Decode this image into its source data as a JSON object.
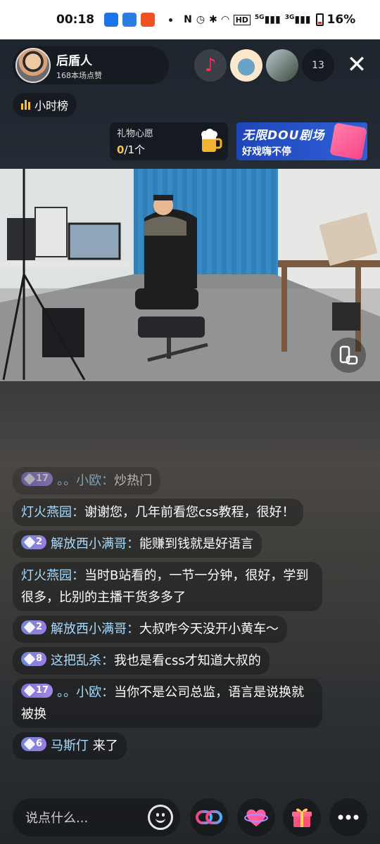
{
  "status_bar": {
    "time": "00:18",
    "network": "5G",
    "network2": "3G",
    "battery": "16%",
    "hd": "HD"
  },
  "host": {
    "name": "后盾人",
    "likes": "168本场点赞"
  },
  "viewers": {
    "count": "13"
  },
  "rank_chip": {
    "label": "小时榜"
  },
  "wish": {
    "title": "礼物心愿",
    "current": "0",
    "total": "/1个"
  },
  "banner": {
    "title": "无限DOU剧场",
    "subtitle": "好戏嗨不停"
  },
  "chat": [
    {
      "badge": "17",
      "badge_type": "fan",
      "user": "。。小欧：",
      "text": "炒热门",
      "faded": true
    },
    {
      "badge": "",
      "badge_type": "",
      "user": "灯火燕园：",
      "text": "谢谢您，几年前看您css教程，很好！",
      "faded": false
    },
    {
      "badge": "2",
      "badge_type": "gem",
      "user": "解放西小满哥：",
      "text": "能赚到钱就是好语言",
      "faded": false
    },
    {
      "badge": "",
      "badge_type": "",
      "user": "灯火燕园：",
      "text": "当时B站看的，一节一分钟，很好，学到很多，比别的主播干货多多了",
      "faded": false
    },
    {
      "badge": "2",
      "badge_type": "gem",
      "user": "解放西小满哥：",
      "text": "大叔咋今天没开小黄车～",
      "faded": false
    },
    {
      "badge": "8",
      "badge_type": "gem",
      "user": "这把乱杀：",
      "text": "我也是看css才知道大叔的",
      "faded": false
    },
    {
      "badge": "17",
      "badge_type": "fan",
      "user": "。。小欧：",
      "text": "当你不是公司总监，语言是说换就被换",
      "faded": false
    },
    {
      "badge": "6",
      "badge_type": "gem",
      "user": "马斯仃",
      "text": " 来了",
      "faded": false
    }
  ],
  "input": {
    "placeholder": "说点什么..."
  },
  "icons": {
    "emoji": "emoji-icon",
    "link": "link-mic-icon",
    "like": "heart-planet-icon",
    "gift": "gift-icon",
    "more": "more-icon"
  }
}
